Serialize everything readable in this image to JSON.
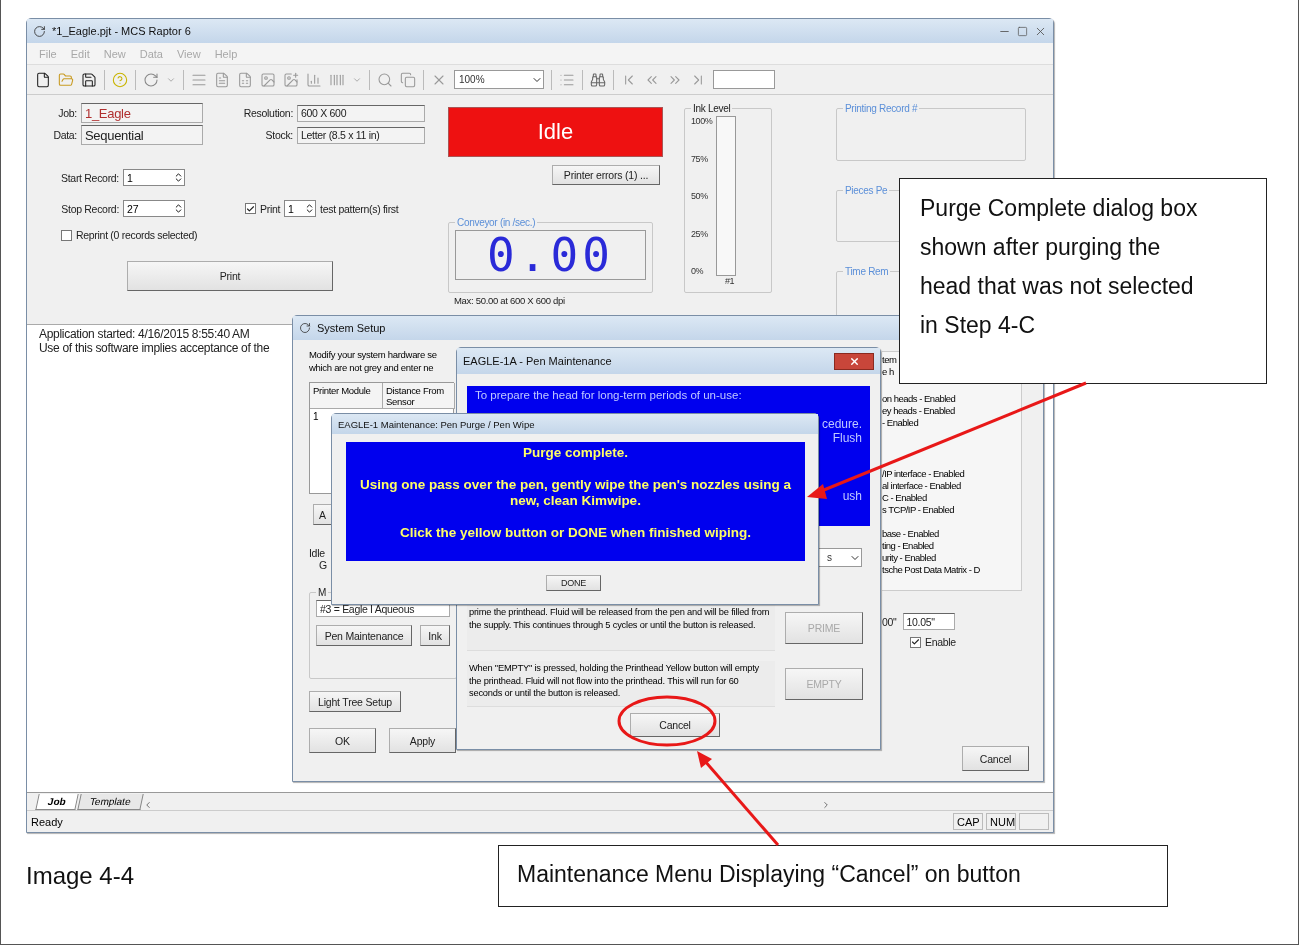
{
  "main_window": {
    "title": "*1_Eagle.pjt - MCS Raptor 6",
    "menu": [
      "File",
      "Edit",
      "New",
      "Data",
      "View",
      "Help"
    ],
    "zoom": "100%",
    "job": {
      "label": "Job:",
      "value": "1_Eagle"
    },
    "data": {
      "label": "Data:",
      "value": "Sequential"
    },
    "resolution": {
      "label": "Resolution:",
      "value": "600 X 600"
    },
    "stock": {
      "label": "Stock:",
      "value": "Letter (8.5 x 11 in)"
    },
    "start_record": {
      "label": "Start Record:",
      "value": "1"
    },
    "stop_record": {
      "label": "Stop Record:",
      "value": "27"
    },
    "test_pattern": {
      "checked": true,
      "label": "Print",
      "value": "1",
      "suffix": "test pattern(s) first"
    },
    "reprint": {
      "checked": false,
      "label": "Reprint (0 records selected)"
    },
    "print_button": "Print",
    "status": "Idle",
    "errors_button": "Printer errors (1) ...",
    "conveyor": {
      "title": "Conveyor (in /sec.)",
      "reading": "0.00",
      "max": "Max: 50.00 at 600 X 600 dpi"
    },
    "ink": {
      "title": "Ink Level",
      "ticks": [
        "100%",
        "75%",
        "50%",
        "25%",
        "0%"
      ],
      "level": 0,
      "head": "#1"
    },
    "groups": [
      "Printing Record #",
      "Pieces Pe",
      "Time Rem"
    ],
    "log": [
      "Application started: 4/16/2015 8:55:40 AM",
      "Use of this software implies acceptance of the"
    ],
    "tabs": [
      {
        "label": "Job",
        "selected": true
      },
      {
        "label": "Template",
        "selected": false
      }
    ],
    "status_bar": {
      "text": "Ready",
      "indicators": [
        "CAP",
        "NUM"
      ]
    }
  },
  "system_setup": {
    "title": "System Setup",
    "intro": [
      "Modify your system hardware se",
      "which are not grey and enter ne"
    ],
    "columns": [
      "Printer Module",
      "Distance From Sensor"
    ],
    "rows": [
      [
        "1"
      ]
    ],
    "partial_button": "A",
    "state_label": "Idle",
    "sub_label": "G",
    "module_group": "M",
    "module": "#3 = Eagle I Aqueous",
    "module_buttons": [
      "Pen Maintenance",
      "Ink"
    ],
    "light_tree_button": "Light Tree Setup",
    "features": [
      [
        "tem",
        "e h"
      ],
      [
        "on heads - Enabled",
        "ey heads - Enabled",
        "- Enabled"
      ],
      [
        "/IP interface - Enabled",
        "al interface - Enabled",
        "C - Enabled",
        "s TCP/IP - Enabled"
      ],
      [
        "base - Enabled",
        "ting - Enabled",
        "urity - Enabled",
        "tsche Post Data Matrix - D"
      ]
    ],
    "distance_label": "00\"",
    "distance": "10.05\"",
    "enable": {
      "checked": true,
      "label": "Enable"
    },
    "ok_button": "OK",
    "apply_button": "Apply",
    "cancel_button": "Cancel"
  },
  "pen_maintenance": {
    "title": "EAGLE-1A - Pen Maintenance",
    "intro": "To prepare the head for long-term periods of un-use:",
    "fragments": [
      "cedure.",
      "Flush",
      "ush"
    ],
    "combo_fragment": "s",
    "prime_text": "prime the printhead. Fluid will be released from the pen and will be filled from the supply.  This continues through 5 cycles or until the button is released.",
    "prime_button": {
      "label": "PRIME",
      "disabled": true
    },
    "empty_text": "When \"EMPTY\" is pressed, holding the Printhead Yellow button will empty the printhead. Fluid will not flow into the printhead. This will run for 60 seconds or until the button is released.",
    "empty_button": {
      "label": "EMPTY",
      "disabled": true
    },
    "cancel_button": "Cancel"
  },
  "purge_dialog": {
    "title": "EAGLE-1 Maintenance:  Pen Purge / Pen Wipe",
    "messages": [
      "Purge complete.",
      "Using one pass over the pen, gently wipe the pen's nozzles using a new, clean Kimwipe.",
      "Click the yellow button or DONE when finished wiping."
    ],
    "button": "DONE"
  },
  "callouts": [
    "Purge Complete dialog box shown after purging the head that was not selected in Step 4-C",
    "Maintenance Menu Displaying “Cancel” on button"
  ],
  "caption": "Image 4-4"
}
